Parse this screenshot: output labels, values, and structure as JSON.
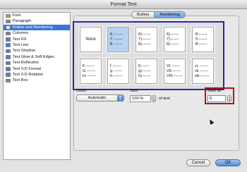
{
  "window": {
    "title": "Format Text"
  },
  "sidebar": {
    "items": [
      {
        "label": "Font",
        "icon": "font-icon",
        "color": "#c9a23e"
      },
      {
        "label": "Paragraph",
        "icon": "paragraph-icon",
        "color": "#7d8a9c"
      },
      {
        "label": "Bullets and Numbering",
        "icon": "bullets-icon",
        "color": "#e7e9ee",
        "selected": true
      },
      {
        "label": "Columns",
        "icon": "columns-icon",
        "color": "#7d8a9c"
      },
      {
        "label": "Text Fill",
        "icon": "text-fill-icon",
        "color": "#4a86c8"
      },
      {
        "label": "Text Line",
        "icon": "text-line-icon",
        "color": "#4a86c8"
      },
      {
        "label": "Text Shadow",
        "icon": "text-shadow-icon",
        "color": "#4a86c8"
      },
      {
        "label": "Text Glow & Soft Edges",
        "icon": "text-glow-icon",
        "color": "#4a86c8"
      },
      {
        "label": "Text Reflection",
        "icon": "text-reflection-icon",
        "color": "#4a86c8"
      },
      {
        "label": "Text 3-D Format",
        "icon": "text-3d-format-icon",
        "color": "#4a86c8"
      },
      {
        "label": "Text 3-D Rotation",
        "icon": "text-3d-rotation-icon",
        "color": "#4a86c8"
      },
      {
        "label": "Text Box",
        "icon": "text-box-icon",
        "color": "#7d8a9c"
      }
    ]
  },
  "tabs": [
    {
      "label": "Bullets",
      "active": false
    },
    {
      "label": "Numbering",
      "active": true
    }
  ],
  "numbering_styles": [
    {
      "id": "none",
      "label": "None",
      "lines": []
    },
    {
      "id": "num-period",
      "lines": [
        "6.",
        "7.",
        "8."
      ],
      "selected": true
    },
    {
      "id": "num-paren",
      "lines": [
        "6)",
        "7)",
        "8)"
      ]
    },
    {
      "id": "num-paren-2",
      "lines": [
        "6)",
        "7)",
        "8)"
      ]
    },
    {
      "id": "num-circled",
      "lines": [
        "⑥",
        "⑦",
        "⑧"
      ]
    },
    {
      "id": "upper-alpha",
      "lines": [
        "F.",
        "G.",
        "H."
      ]
    },
    {
      "id": "lower-alpha-period",
      "lines": [
        "f.",
        "g.",
        "h."
      ]
    },
    {
      "id": "lower-alpha-paren",
      "lines": [
        "f)",
        "g)",
        "h)"
      ]
    },
    {
      "id": "upper-roman",
      "lines": [
        "VI.",
        "VII.",
        "VIII."
      ]
    },
    {
      "id": "lower-roman",
      "lines": [
        "vi.",
        "vii.",
        "viii."
      ]
    }
  ],
  "color": {
    "label": "Color:",
    "value": "Automatic"
  },
  "size": {
    "label": "Size:",
    "value": "100 %",
    "suffix": "of text"
  },
  "start_at": {
    "label": "Start at:",
    "value": "6"
  },
  "buttons": {
    "cancel": "Cancel",
    "ok": "OK"
  },
  "colors": {
    "highlight_box": "#30279c",
    "start_box": "#b1141b",
    "selection": "#3875d7"
  }
}
